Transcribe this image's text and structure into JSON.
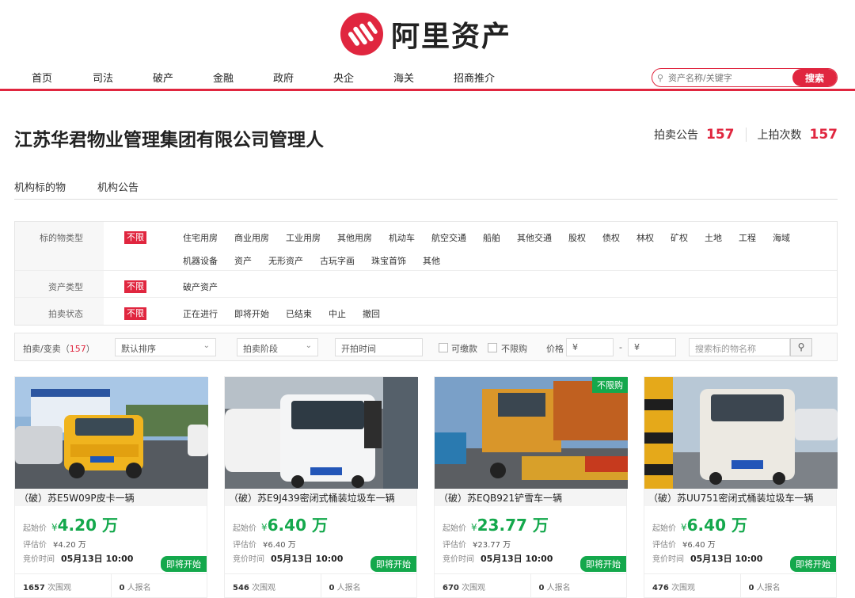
{
  "brand": {
    "name": "阿里资产",
    "accent": "#e0263f",
    "green": "#14a84c"
  },
  "nav": [
    "首页",
    "司法",
    "破产",
    "金融",
    "政府",
    "央企",
    "海关",
    "招商推介"
  ],
  "search": {
    "placeholder": "资产名称/关键字",
    "button": "搜索"
  },
  "org": {
    "title": "江苏华君物业管理集团有限公司管理人",
    "notice_label": "拍卖公告",
    "notice_count": "157",
    "listings_label": "上拍次数",
    "listings_count": "157"
  },
  "tabs": [
    "机构标的物",
    "机构公告"
  ],
  "filters": [
    {
      "label": "标的物类型",
      "unlimited": "不限",
      "options": [
        "住宅用房",
        "商业用房",
        "工业用房",
        "其他用房",
        "机动车",
        "航空交通",
        "船舶",
        "其他交通",
        "股权",
        "债权",
        "林权",
        "矿权",
        "土地",
        "工程",
        "海域",
        "机器设备",
        "资产",
        "无形资产",
        "古玩字画",
        "珠宝首饰",
        "其他"
      ]
    },
    {
      "label": "资产类型",
      "unlimited": "不限",
      "options": [
        "破产资产"
      ]
    },
    {
      "label": "拍卖状态",
      "unlimited": "不限",
      "options": [
        "正在进行",
        "即将开始",
        "已结束",
        "中止",
        "撤回"
      ]
    }
  ],
  "toolbar": {
    "sale_label": "拍卖/变卖（",
    "sale_count": "157",
    "sale_close": "）",
    "sort": "默认排序",
    "stage": "拍卖阶段",
    "start_time": "开拍时间",
    "deposit": "可缴款",
    "no_limit": "不限购",
    "price_label": "价格",
    "price_min": "¥",
    "dash": "-",
    "price_max": "¥",
    "search_placeholder": "搜索标的物名称"
  },
  "cards": [
    {
      "title": "（破）苏E5W09P皮卡一辆",
      "start_label": "起始价",
      "currency": "¥",
      "price": "4.20 万",
      "est_label": "评估价",
      "est": "¥4.20 万",
      "time_label": "竞价时间",
      "time": "05月13日 10:00",
      "status": "即将开始",
      "views": "1657",
      "views_label": "次围观",
      "signups": "0",
      "signups_label": "人报名",
      "ribbon": ""
    },
    {
      "title": "（破）苏E9J439密闭式桶装垃圾车一辆",
      "start_label": "起始价",
      "currency": "¥",
      "price": "6.40 万",
      "est_label": "评估价",
      "est": "¥6.40 万",
      "time_label": "竞价时间",
      "time": "05月13日 10:00",
      "status": "即将开始",
      "views": "546",
      "views_label": "次围观",
      "signups": "0",
      "signups_label": "人报名",
      "ribbon": ""
    },
    {
      "title": "（破）苏EQB921铲雪车一辆",
      "start_label": "起始价",
      "currency": "¥",
      "price": "23.77 万",
      "est_label": "评估价",
      "est": "¥23.77 万",
      "time_label": "竞价时间",
      "time": "05月13日 10:00",
      "status": "即将开始",
      "views": "670",
      "views_label": "次围观",
      "signups": "0",
      "signups_label": "人报名",
      "ribbon": "不限购"
    },
    {
      "title": "（破）苏UU751密闭式桶装垃圾车一辆",
      "start_label": "起始价",
      "currency": "¥",
      "price": "6.40 万",
      "est_label": "评估价",
      "est": "¥6.40 万",
      "time_label": "竞价时间",
      "time": "05月13日 10:00",
      "status": "即将开始",
      "views": "476",
      "views_label": "次围观",
      "signups": "0",
      "signups_label": "人报名",
      "ribbon": ""
    }
  ]
}
